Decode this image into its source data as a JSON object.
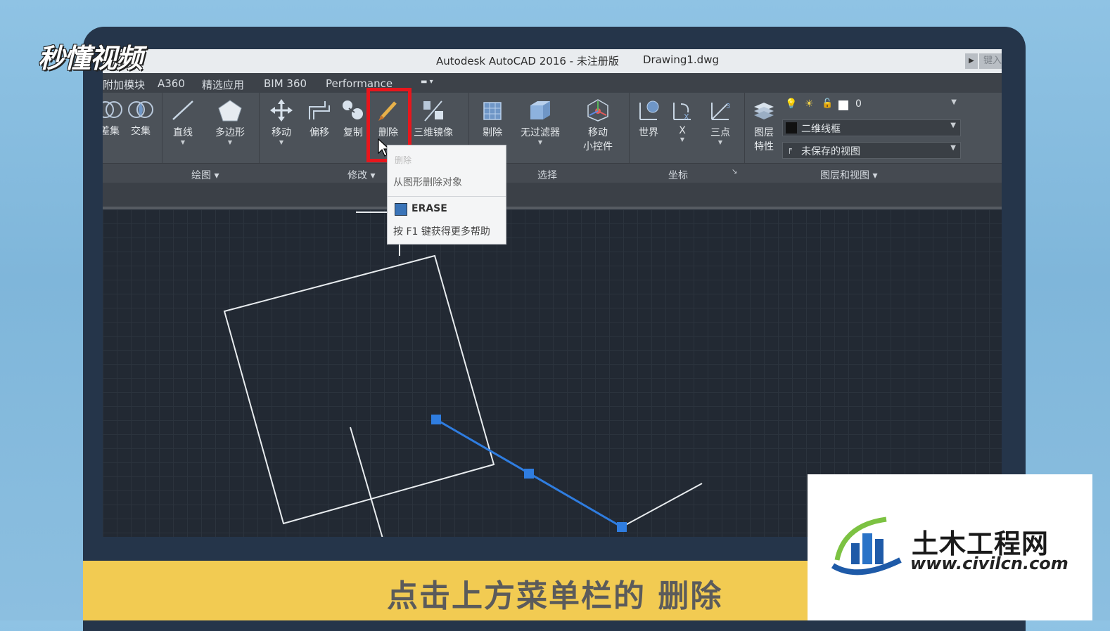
{
  "logo": {
    "text": "秒懂视频"
  },
  "window": {
    "title_app": "Autodesk AutoCAD 2016 - 未注册版",
    "title_file": "Drawing1.dwg",
    "search_placeholder": "键入"
  },
  "menu": {
    "tabs": [
      "附加模块",
      "A360",
      "精选应用",
      "BIM 360",
      "Performance"
    ]
  },
  "ribbon": {
    "tools": {
      "subtract": "差集",
      "intersect": "交集",
      "line": "直线",
      "polygon": "多边形",
      "move": "移动",
      "offset": "偏移",
      "copy": "复制",
      "erase": "删除",
      "mirror3d": "三维镜像",
      "cull": "剔除",
      "nofilter": "无过滤器",
      "gizmo_line1": "移动",
      "gizmo_line2": "小控件",
      "world": "世界",
      "x": "X",
      "threepoint": "三点",
      "layerprop_line1": "图层",
      "layerprop_line2": "特性"
    },
    "panels": {
      "draw": "绘图",
      "modify": "修改",
      "select": "选择",
      "coords": "坐标",
      "layers_views": "图层和视图"
    },
    "layer_current": "0",
    "visual_style": "二维线框",
    "view": "未保存的视图"
  },
  "tooltip": {
    "title": "删除",
    "description": "从图形删除对象",
    "command": "ERASE",
    "help": "按 F1 键获得更多帮助"
  },
  "caption": "点击上方菜单栏的 删除",
  "watermark": {
    "name": "土木工程网",
    "url": "www.civilcn.com"
  },
  "colors": {
    "highlight": "#e8161c",
    "selection": "#2f7de0",
    "caption_bar": "#f2cb52"
  }
}
